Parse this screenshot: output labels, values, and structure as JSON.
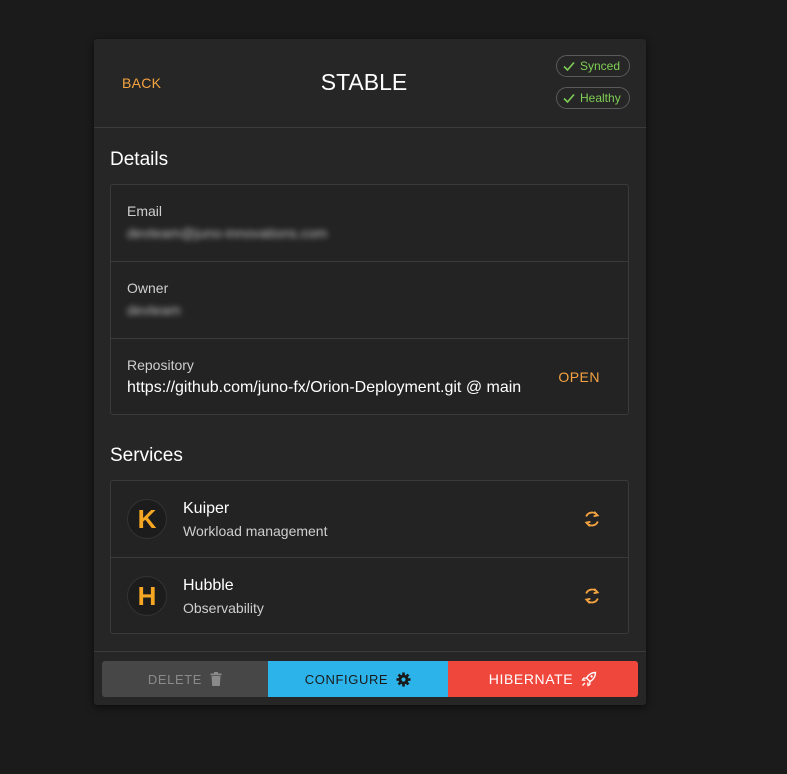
{
  "header": {
    "back_label": "BACK",
    "title": "STABLE",
    "status_chips": [
      {
        "label": "Synced",
        "icon": "check-icon",
        "color": "#7ecf54"
      },
      {
        "label": "Healthy",
        "icon": "check-icon",
        "color": "#7ecf54"
      }
    ]
  },
  "details": {
    "title": "Details",
    "email": {
      "label": "Email",
      "value": "devteam@juno-innovations.com"
    },
    "owner": {
      "label": "Owner",
      "value": "devteam"
    },
    "repository": {
      "label": "Repository",
      "value": "https://github.com/juno-fx/Orion-Deployment.git @ main",
      "open_label": "OPEN"
    }
  },
  "services": {
    "title": "Services",
    "items": [
      {
        "name": "Kuiper",
        "description": "Workload management",
        "avatar_letter": "K",
        "icon": "refresh-icon"
      },
      {
        "name": "Hubble",
        "description": "Observability",
        "avatar_letter": "H",
        "icon": "refresh-icon"
      }
    ]
  },
  "footer": {
    "delete_label": "DELETE",
    "configure_label": "CONFIGURE",
    "hibernate_label": "HIBERNATE"
  },
  "colors": {
    "accent_orange": "#f5a340",
    "configure_blue": "#2cb4ea",
    "hibernate_red": "#f0473c",
    "healthy_green": "#7ecf54"
  }
}
